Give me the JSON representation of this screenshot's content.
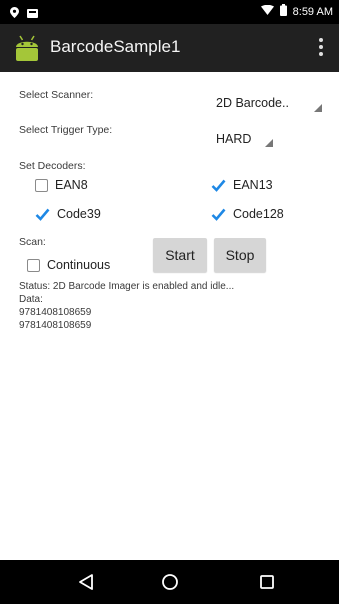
{
  "status_bar": {
    "time": "8:59 AM",
    "icons": [
      "location-icon",
      "notification-icon",
      "wifi-icon",
      "battery-icon"
    ]
  },
  "app_bar": {
    "title": "BarcodeSample1",
    "icon": "android-icon",
    "menu_icon": "overflow-menu-icon"
  },
  "scanner": {
    "label": "Select Scanner:",
    "value": "2D Barcode.."
  },
  "trigger": {
    "label": "Select Trigger Type:",
    "value": "HARD"
  },
  "decoders": {
    "label": "Set Decoders:",
    "items": [
      {
        "label": "EAN8",
        "checked": false
      },
      {
        "label": "EAN13",
        "checked": true
      },
      {
        "label": "Code39",
        "checked": true
      },
      {
        "label": "Code128",
        "checked": true
      }
    ]
  },
  "scan": {
    "label": "Scan:",
    "continuous": {
      "label": "Continuous",
      "checked": false
    },
    "start_label": "Start",
    "stop_label": "Stop"
  },
  "status_text": "Status: 2D Barcode Imager is enabled and idle...",
  "data_label": "Data:",
  "data_lines": [
    "9781408108659",
    "9781408108659"
  ],
  "colors": {
    "status_bar": "#000000",
    "app_bar": "#212121",
    "check_accent": "#1e88e5",
    "android_green": "#a4c639",
    "button": "#d6d6d6"
  },
  "nav": [
    "back-icon",
    "home-icon",
    "recents-icon"
  ]
}
